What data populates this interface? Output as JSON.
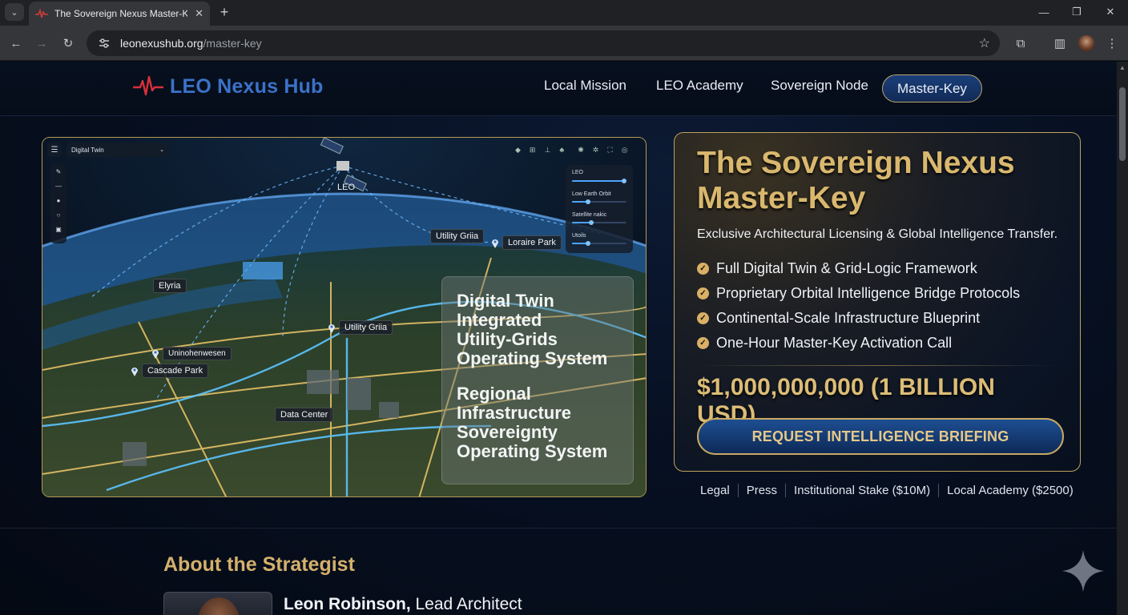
{
  "browser": {
    "tab_title": "The Sovereign Nexus Master-Key",
    "url_domain": "leonexushub.org",
    "url_path": "/master-key"
  },
  "header": {
    "logo_text": "LEO Nexus Hub",
    "nav": [
      "Local Mission",
      "LEO Academy",
      "Sovereign Node",
      "Master-Key"
    ],
    "active_nav": "Master-Key"
  },
  "hero": {
    "view_select": "Digital Twin",
    "satellite_label": "LEO",
    "panel": {
      "title": "LEO",
      "items": [
        "Low Earth Orbit",
        "Satellite nakic",
        "Utoils"
      ],
      "levels": [
        0.95,
        0.3,
        0.35,
        0.3
      ]
    },
    "place_labels": [
      "Utility Griia",
      "Loraire Park",
      "Elyria",
      "Utility Griia",
      "Uninohenwesen",
      "Cascade Park",
      "Data Center"
    ],
    "overlay_line1": "Digital Twin\nIntegrated\nUtility-Grids\nOperating System",
    "overlay_line2": "Regional\nInfrastructure\nSovereignty\nOperating System"
  },
  "offer": {
    "title": "The Sovereign Nexus\nMaster-Key",
    "subtitle": "Exclusive Architectural Licensing & Global Intelligence Transfer.",
    "features": [
      "Full Digital Twin & Grid-Logic Framework",
      "Proprietary Orbital Intelligence Bridge Protocols",
      "Continental-Scale Infrastructure Blueprint",
      "One-Hour Master-Key Activation Call"
    ],
    "price": "$1,000,000,000 (1 BILLION USD)",
    "cta": "REQUEST INTELLIGENCE BRIEFING"
  },
  "footer_links": [
    "Legal",
    "Press",
    "Institutional Stake ($10M)",
    "Local Academy ($2500)"
  ],
  "about": {
    "heading": "About the Strategist",
    "name": "Leon Robinson,",
    "role": " Lead Architect"
  },
  "colors": {
    "gold": "#d4b06c",
    "brand_blue": "#3b72c9",
    "page_bg": "#050b18"
  }
}
